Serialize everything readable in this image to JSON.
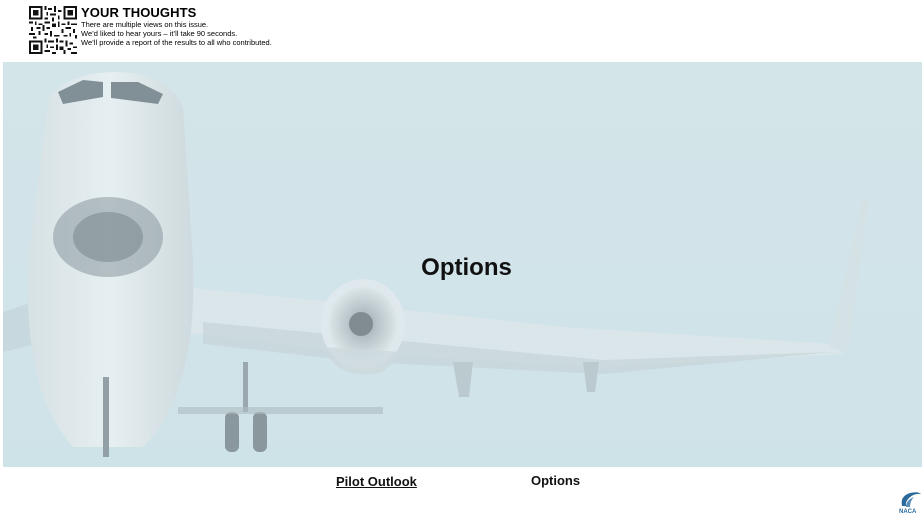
{
  "header": {
    "title": "YOUR THOUGHTS",
    "lines": [
      "There are multiple views on this issue.",
      "We’d liked to hear yours – it’ll take 90 seconds.",
      "We’ll provide a report of the results to all who contributed."
    ],
    "qr_icon": "qr-code-icon"
  },
  "hero": {
    "title": "Options",
    "image": "airplane-photo"
  },
  "footer": {
    "link_label": "Pilot Outlook",
    "current_label": "Options",
    "logo_text": "NACA"
  },
  "colors": {
    "sky": "#cfe2e7",
    "text": "#111111",
    "logo": "#2a6a9a"
  }
}
